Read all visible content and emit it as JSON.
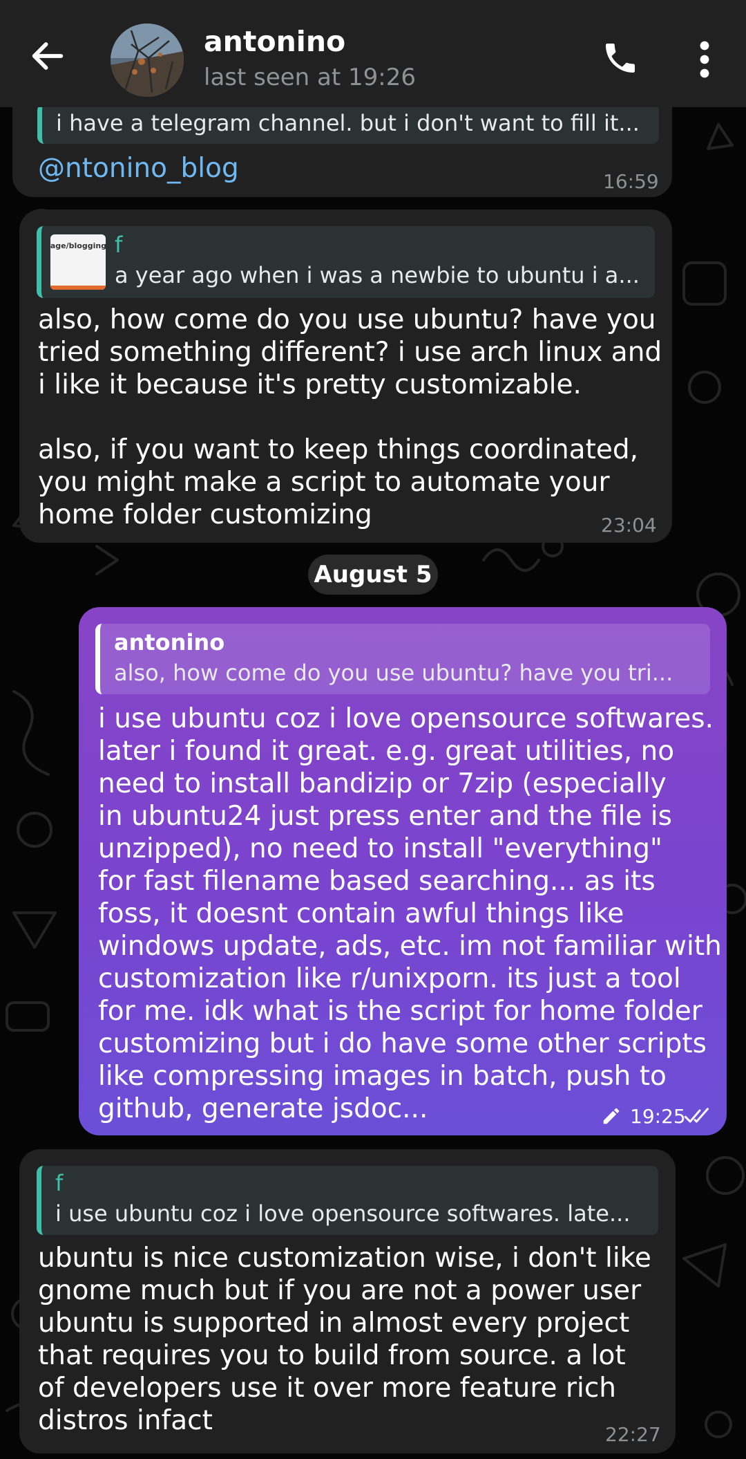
{
  "header": {
    "name": "antonino",
    "status": "last seen at 19:26"
  },
  "messages": [
    {
      "reply_text": "i have a telegram channel. but i don't want to fill it...",
      "link": "@ntonino_blog",
      "time": "16:59"
    },
    {
      "reply_name": "f",
      "reply_text": "a year ago when i was a newbie to ubuntu i a...",
      "reply_thumb_text": "page/blogging",
      "text": "also, how come do you use ubuntu? have you\ntried something different? i use arch linux and\ni like it because it's pretty customizable.\n\nalso, if you want to keep things coordinated,\nyou might make a script to automate your\nhome folder customizing",
      "time": "23:04"
    },
    {
      "date": "August 5"
    },
    {
      "reply_name": "antonino",
      "reply_text": "also, how come do you use ubuntu? have you tri...",
      "text": "i use ubuntu coz i love opensource softwares.\nlater i found it great. e.g. great utilities, no\nneed to install bandizip or 7zip (especially\nin ubuntu24 just press enter and the file is\nunzipped), no need to install \"everything\"\nfor fast filename based searching... as its\nfoss, it doesnt contain awful things like\nwindows update, ads, etc. im not familiar with\ncustomization like r/unixporn. its just a tool\nfor me. idk what is the script for home folder\ncustomizing but i do have some other scripts\nlike compressing images in batch, push to\ngithub, generate jsdoc...",
      "time": "19:25"
    },
    {
      "reply_name": "f",
      "reply_text": "i use ubuntu coz i love opensource softwares. late...",
      "text": "ubuntu is nice customization wise, i don't like\ngnome much but if you are not a power user\nubuntu is supported in almost every project\nthat requires you to build from source. a lot\nof developers use it over more feature rich\ndistros infact",
      "time": "22:27"
    }
  ],
  "colors": {
    "background": "#050505",
    "header": "#212121",
    "incoming_bubble": "#212121",
    "outgoing_bubble_top": "#8745c6",
    "outgoing_bubble_bottom": "#6c4fd7",
    "reply_accent": "#41c1ab",
    "link": "#6fb8f2"
  },
  "icons": [
    "back-arrow-icon",
    "phone-icon",
    "more-vertical-icon",
    "edit-pencil-icon",
    "double-check-icon"
  ]
}
